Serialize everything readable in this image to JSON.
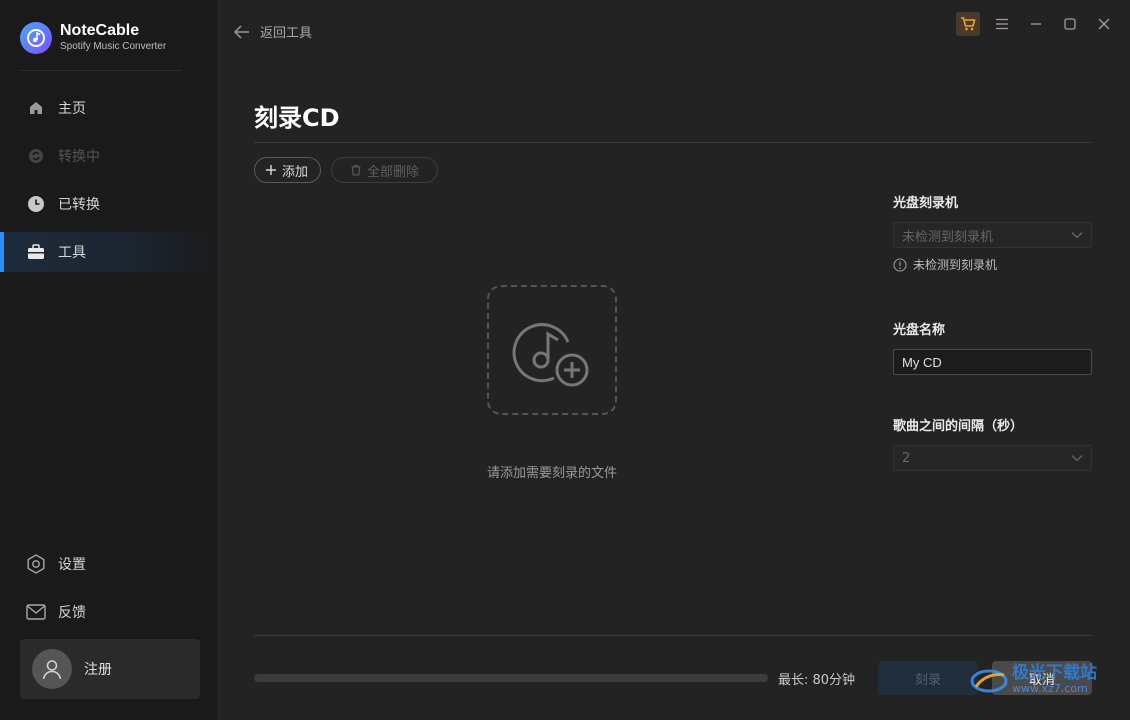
{
  "app": {
    "name": "NoteCable",
    "subtitle": "Spotify Music Converter"
  },
  "sidebar": {
    "items": [
      {
        "label": "主页",
        "icon": "home-icon",
        "state": "normal"
      },
      {
        "label": "转换中",
        "icon": "sync-icon",
        "state": "disabled"
      },
      {
        "label": "已转换",
        "icon": "clock-icon",
        "state": "normal"
      },
      {
        "label": "工具",
        "icon": "toolbox-icon",
        "state": "active"
      }
    ],
    "bottom_items": [
      {
        "label": "设置",
        "icon": "gear-icon"
      },
      {
        "label": "反馈",
        "icon": "mail-icon"
      }
    ],
    "user": {
      "label": "注册"
    }
  },
  "header": {
    "back_label": "返回工具"
  },
  "main": {
    "title": "刻录CD",
    "add_label": "添加",
    "delete_all_label": "全部删除",
    "drop_hint": "请添加需要刻录的文件"
  },
  "panel": {
    "burner_label": "光盘刻录机",
    "burner_value": "未检测到刻录机",
    "burner_note": "未检测到刻录机",
    "disc_name_label": "光盘名称",
    "disc_name_value": "My CD",
    "gap_label": "歌曲之间的间隔（秒）",
    "gap_value": "2"
  },
  "footer": {
    "progress": 0,
    "max_length": "最长: 80分钟",
    "burn_label": "刻录",
    "cancel_label": "取消"
  },
  "watermark": {
    "text": "极光下载站",
    "url": "www.xz7.com"
  },
  "colors": {
    "accent": "#2f8cff",
    "background": "#232323",
    "sidebar": "#1a1a1a"
  }
}
